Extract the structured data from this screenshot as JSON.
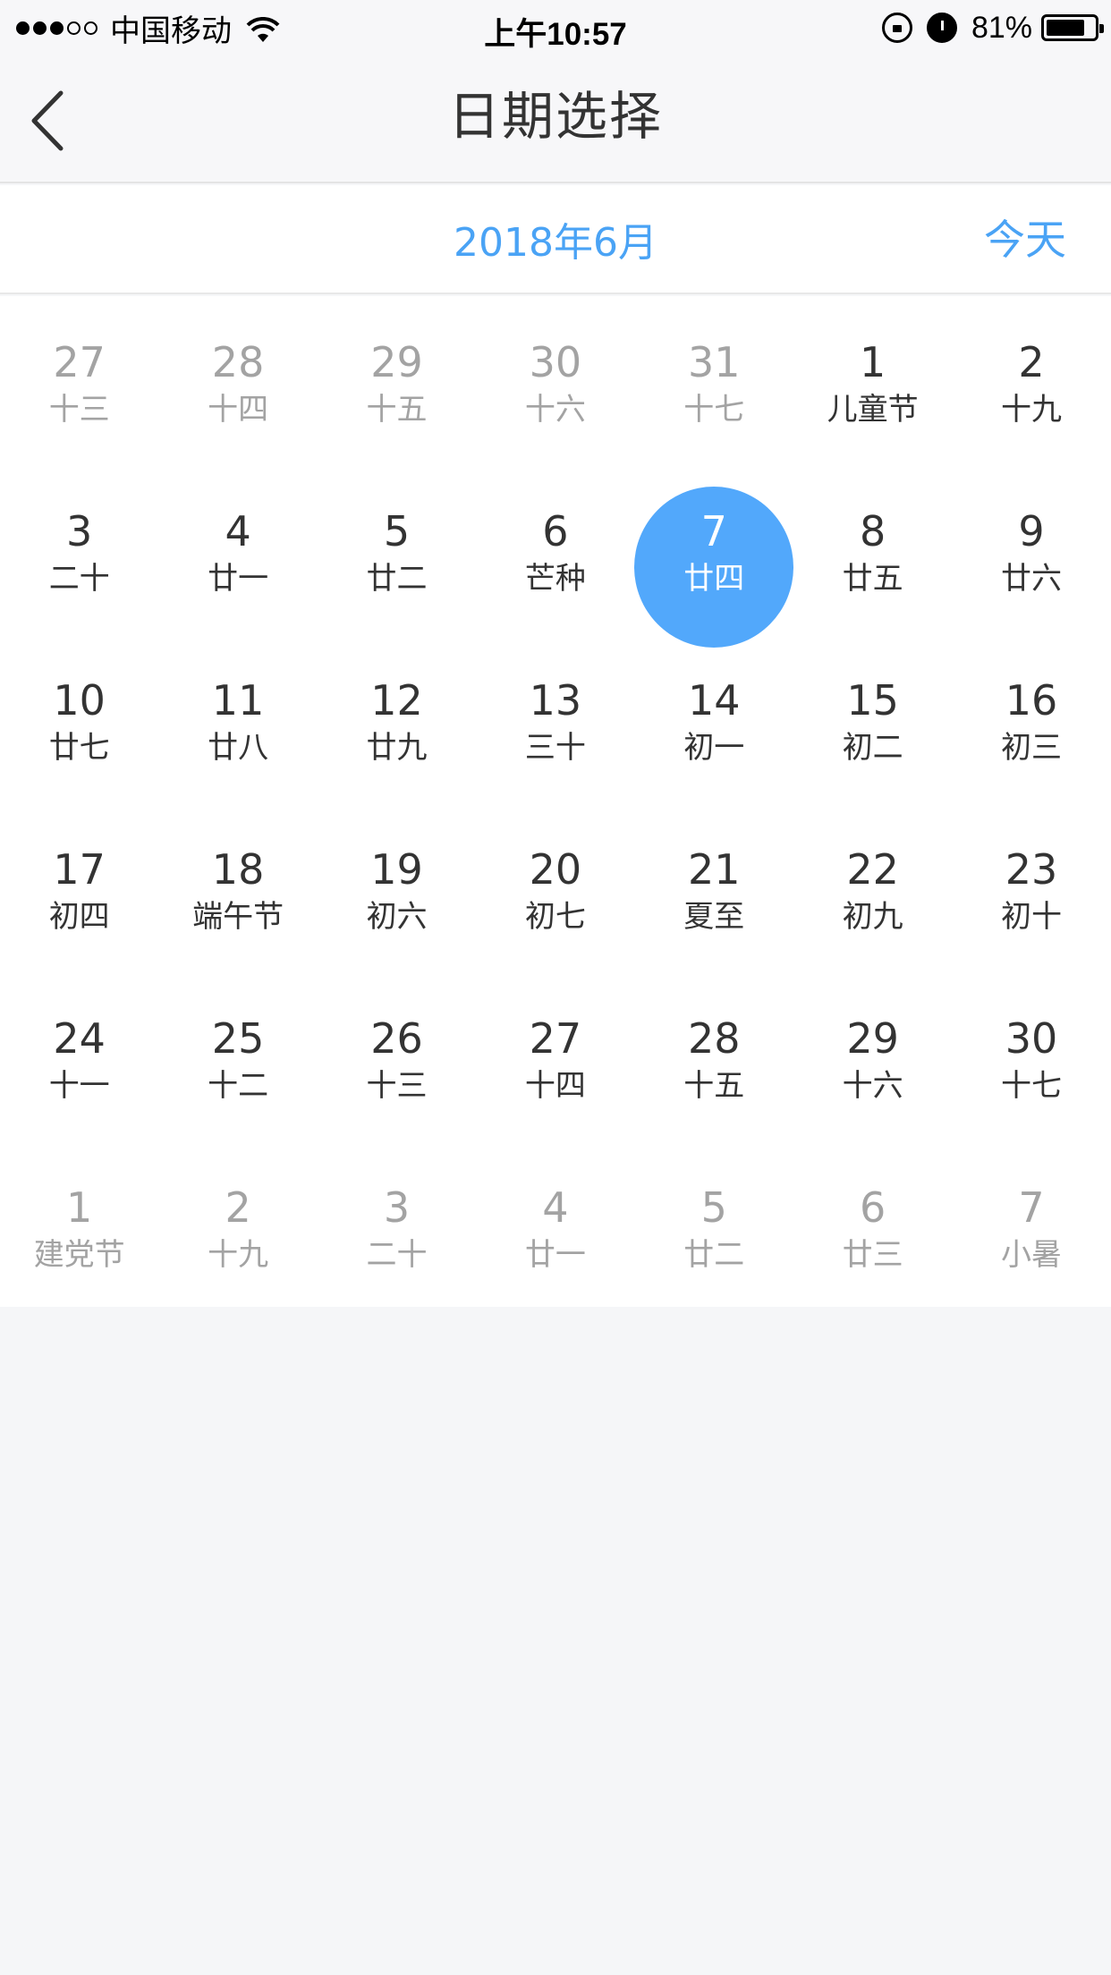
{
  "status_bar": {
    "carrier": "中国移动",
    "time": "上午10:57",
    "battery": "81%",
    "battery_level": 0.81,
    "signal_strength": 3,
    "signal_max": 5
  },
  "nav": {
    "title": "日期选择",
    "back_icon": "chevron-left-icon"
  },
  "calendar": {
    "month_title": "2018年6月",
    "today_label": "今天",
    "accent_color": "#4aa3f5",
    "selected_color": "#52a8fb",
    "weeks": [
      [
        {
          "day": "27",
          "lunar": "十三",
          "current": false
        },
        {
          "day": "28",
          "lunar": "十四",
          "current": false
        },
        {
          "day": "29",
          "lunar": "十五",
          "current": false
        },
        {
          "day": "30",
          "lunar": "十六",
          "current": false
        },
        {
          "day": "31",
          "lunar": "十七",
          "current": false
        },
        {
          "day": "1",
          "lunar": "儿童节",
          "current": true
        },
        {
          "day": "2",
          "lunar": "十九",
          "current": true
        }
      ],
      [
        {
          "day": "3",
          "lunar": "二十",
          "current": true
        },
        {
          "day": "4",
          "lunar": "廿一",
          "current": true
        },
        {
          "day": "5",
          "lunar": "廿二",
          "current": true
        },
        {
          "day": "6",
          "lunar": "芒种",
          "current": true
        },
        {
          "day": "7",
          "lunar": "廿四",
          "current": true,
          "selected": true
        },
        {
          "day": "8",
          "lunar": "廿五",
          "current": true
        },
        {
          "day": "9",
          "lunar": "廿六",
          "current": true
        }
      ],
      [
        {
          "day": "10",
          "lunar": "廿七",
          "current": true
        },
        {
          "day": "11",
          "lunar": "廿八",
          "current": true
        },
        {
          "day": "12",
          "lunar": "廿九",
          "current": true
        },
        {
          "day": "13",
          "lunar": "三十",
          "current": true
        },
        {
          "day": "14",
          "lunar": "初一",
          "current": true
        },
        {
          "day": "15",
          "lunar": "初二",
          "current": true
        },
        {
          "day": "16",
          "lunar": "初三",
          "current": true
        }
      ],
      [
        {
          "day": "17",
          "lunar": "初四",
          "current": true
        },
        {
          "day": "18",
          "lunar": "端午节",
          "current": true
        },
        {
          "day": "19",
          "lunar": "初六",
          "current": true
        },
        {
          "day": "20",
          "lunar": "初七",
          "current": true
        },
        {
          "day": "21",
          "lunar": "夏至",
          "current": true
        },
        {
          "day": "22",
          "lunar": "初九",
          "current": true
        },
        {
          "day": "23",
          "lunar": "初十",
          "current": true
        }
      ],
      [
        {
          "day": "24",
          "lunar": "十一",
          "current": true
        },
        {
          "day": "25",
          "lunar": "十二",
          "current": true
        },
        {
          "day": "26",
          "lunar": "十三",
          "current": true
        },
        {
          "day": "27",
          "lunar": "十四",
          "current": true
        },
        {
          "day": "28",
          "lunar": "十五",
          "current": true
        },
        {
          "day": "29",
          "lunar": "十六",
          "current": true
        },
        {
          "day": "30",
          "lunar": "十七",
          "current": true
        }
      ],
      [
        {
          "day": "1",
          "lunar": "建党节",
          "current": false
        },
        {
          "day": "2",
          "lunar": "十九",
          "current": false
        },
        {
          "day": "3",
          "lunar": "二十",
          "current": false
        },
        {
          "day": "4",
          "lunar": "廿一",
          "current": false
        },
        {
          "day": "5",
          "lunar": "廿二",
          "current": false
        },
        {
          "day": "6",
          "lunar": "廿三",
          "current": false
        },
        {
          "day": "7",
          "lunar": "小暑",
          "current": false
        }
      ]
    ]
  }
}
